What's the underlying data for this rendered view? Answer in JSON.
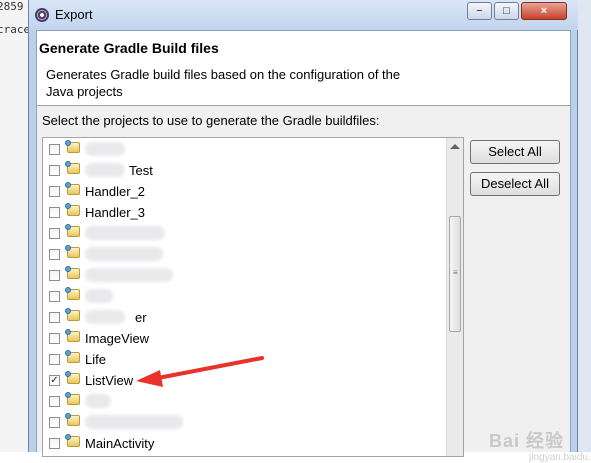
{
  "background": {
    "left_fragments": [
      "2859",
      "crace"
    ]
  },
  "window": {
    "title": "Export",
    "buttons": {
      "minimize": "−",
      "maximize": "□",
      "close": "×"
    }
  },
  "header": {
    "title": "Generate Gradle Build files",
    "description": "Generates Gradle build files based on the configuration of the Java projects"
  },
  "prompt": "Select the projects to use to generate the Gradle buildfiles:",
  "projects": [
    {
      "label": "",
      "checked": false
    },
    {
      "label": "Test",
      "checked": false
    },
    {
      "label": "Handler_2",
      "checked": false
    },
    {
      "label": "Handler_3",
      "checked": false
    },
    {
      "label": "",
      "checked": false
    },
    {
      "label": "",
      "checked": false
    },
    {
      "label": "",
      "checked": false
    },
    {
      "label": "",
      "checked": false
    },
    {
      "label": "er",
      "checked": false
    },
    {
      "label": "ImageView",
      "checked": false
    },
    {
      "label": "Life",
      "checked": false
    },
    {
      "label": "ListView",
      "checked": true
    },
    {
      "label": "",
      "checked": false
    },
    {
      "label": "",
      "checked": false
    },
    {
      "label": "MainActivity",
      "checked": false
    }
  ],
  "buttons": {
    "select_all": "Select All",
    "deselect_all": "Deselect All"
  },
  "annotation": {
    "color": "#e8322a"
  },
  "watermark": {
    "text": "Bai 经验",
    "sub": "jingyan.baidu.com"
  },
  "colors": {
    "titlebar": "#c2d5ee",
    "accent_arrow": "#e8322a"
  }
}
